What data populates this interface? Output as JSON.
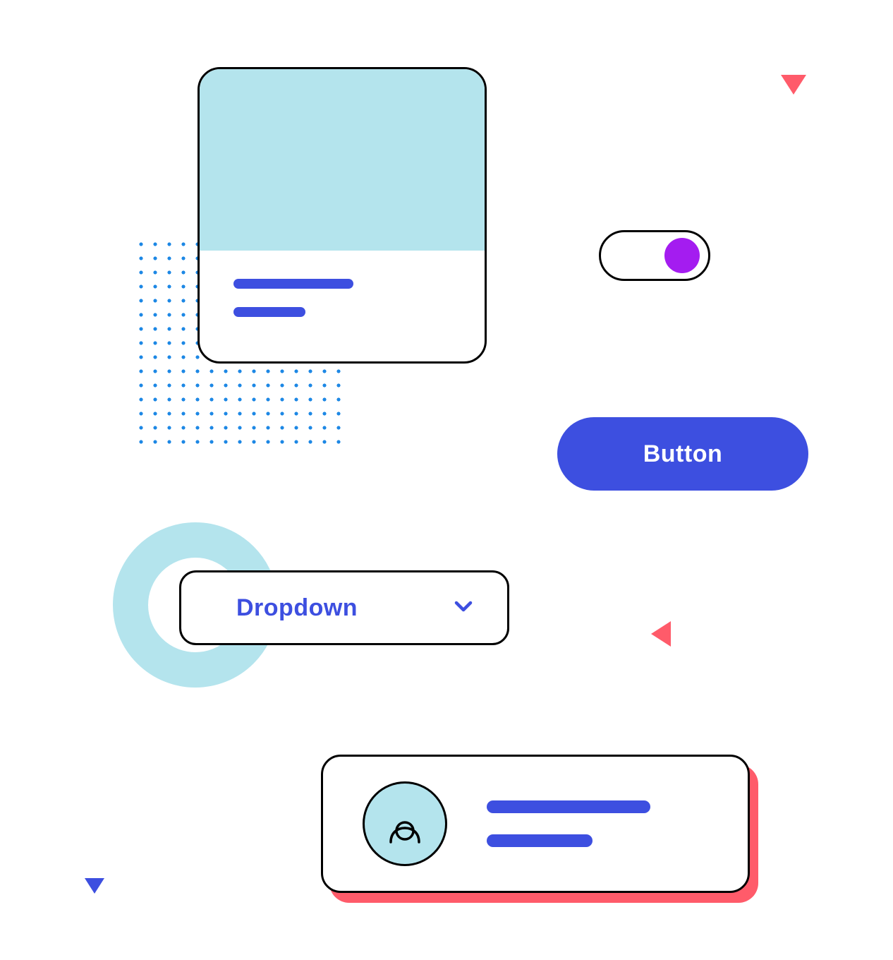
{
  "colors": {
    "primary": "#3d4fe0",
    "accent": "#a41cf0",
    "pale_cyan": "#b4e4ed",
    "coral": "#ff5b6a",
    "black": "#000000",
    "white": "#ffffff"
  },
  "button": {
    "label": "Button"
  },
  "dropdown": {
    "label": "Dropdown"
  },
  "toggle": {
    "state": "on"
  },
  "icons": {
    "chevron_down": "chevron-down-icon",
    "user": "user-icon"
  }
}
